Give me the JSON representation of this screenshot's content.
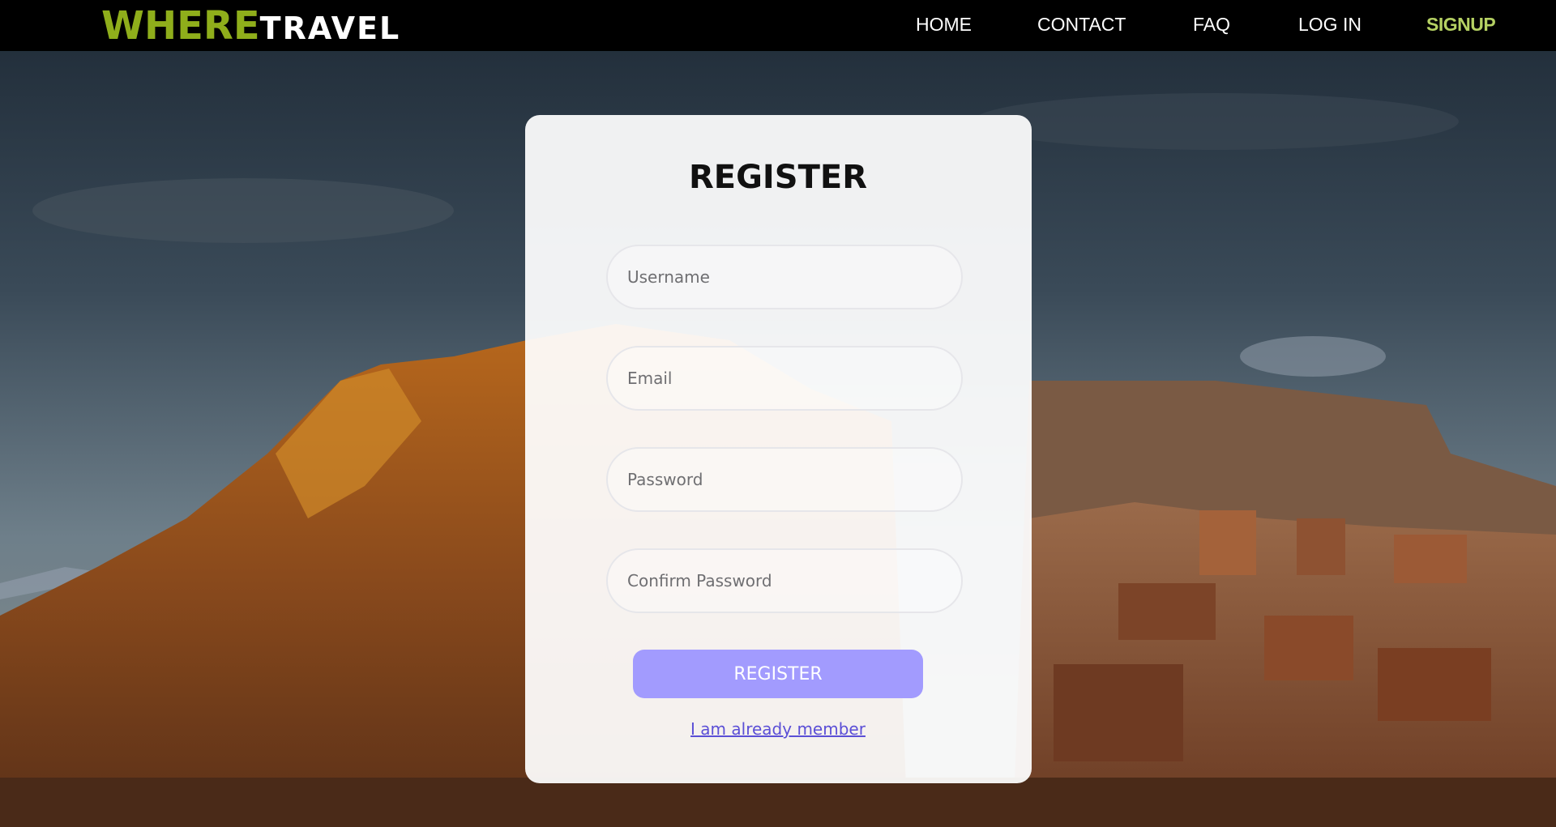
{
  "nav": {
    "logo_where": "WHERE",
    "logo_travel": "TRAVEL",
    "links": {
      "home": "HOME",
      "contact": "CONTACT",
      "faq": "FAQ",
      "login": "LOG IN",
      "signup": "SIGNUP"
    }
  },
  "form": {
    "title": "REGISTER",
    "username_placeholder": "Username",
    "email_placeholder": "Email",
    "password_placeholder": "Password",
    "confirm_placeholder": "Confirm Password",
    "submit_label": "REGISTER",
    "member_link": "I am already member"
  },
  "colors": {
    "accent_button": "#a29bfe",
    "logo_green": "#8fae1b",
    "signup_green": "#b5d163",
    "link_purple": "#5b4fd6"
  }
}
